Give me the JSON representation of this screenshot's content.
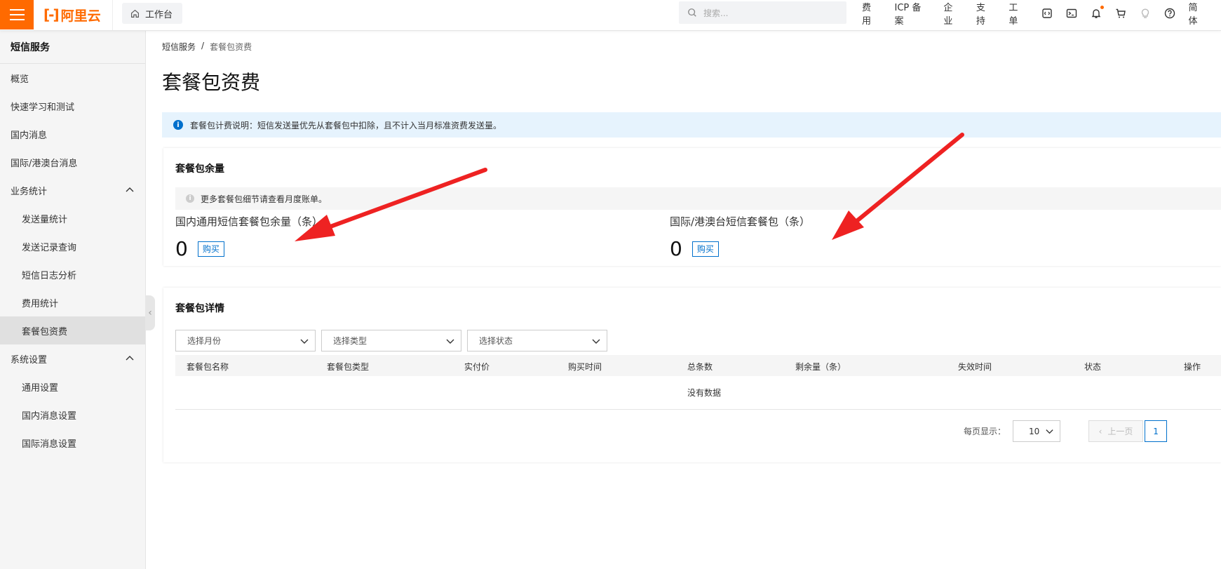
{
  "header": {
    "logo_text": "阿里云",
    "workbench_label": "工作台",
    "search_placeholder": "搜索...",
    "nav_items": [
      "费用",
      "ICP 备案",
      "企业",
      "支持",
      "工单"
    ],
    "language": "简体"
  },
  "sidebar": {
    "title": "短信服务",
    "items": [
      {
        "label": "概览"
      },
      {
        "label": "快速学习和测试"
      },
      {
        "label": "国内消息"
      },
      {
        "label": "国际/港澳台消息"
      },
      {
        "label": "业务统计"
      },
      {
        "label": "发送量统计"
      },
      {
        "label": "发送记录查询"
      },
      {
        "label": "短信日志分析"
      },
      {
        "label": "费用统计"
      },
      {
        "label": "套餐包资费"
      },
      {
        "label": "系统设置"
      },
      {
        "label": "通用设置"
      },
      {
        "label": "国内消息设置"
      },
      {
        "label": "国际消息设置"
      }
    ]
  },
  "breadcrumb": {
    "root": "短信服务",
    "sep": "/",
    "current": "套餐包资费"
  },
  "page_title": "套餐包资费",
  "notice": "套餐包计费说明：短信发送量优先从套餐包中扣除，且不计入当月标准资费发送量。",
  "balance_card": {
    "title": "套餐包余量",
    "hint": "更多套餐包细节请查看月度账单。",
    "domestic": {
      "label": "国内通用短信套餐包余量（条）",
      "value": "0",
      "buy": "购买"
    },
    "international": {
      "label": "国际/港澳台短信套餐包（条）",
      "value": "0",
      "buy": "购买"
    }
  },
  "detail_card": {
    "title": "套餐包详情",
    "filters": [
      "选择月份",
      "选择类型",
      "选择状态"
    ],
    "columns": [
      "套餐包名称",
      "套餐包类型",
      "实付价",
      "购买时间",
      "总条数",
      "剩余量（条）",
      "失效时间",
      "状态",
      "操作"
    ],
    "empty_text": "没有数据",
    "pager": {
      "page_size_label": "每页显示：",
      "page_size": "10",
      "prev": "上一页",
      "current_page": "1"
    }
  },
  "colors": {
    "brand": "#ff6a00",
    "link": "#0070cc",
    "annotation_arrow": "#ee2222"
  }
}
